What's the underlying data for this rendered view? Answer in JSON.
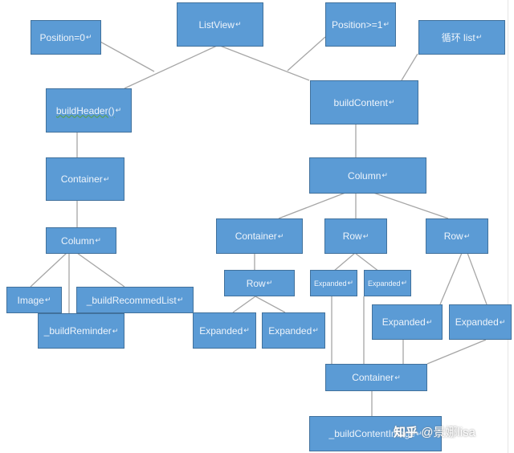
{
  "nodes": {
    "position0": "Position=0",
    "listview": "ListView",
    "position1": "Position>=1",
    "loop_list": "循环 list",
    "build_header": "buildHeader()",
    "build_content": "buildContent",
    "container_left": "Container",
    "column_left": "Column",
    "image": "Image",
    "build_recommed_list": "_buildRecommedList",
    "build_reminder": "_buildReminder",
    "column_right": "Column",
    "container_mid": "Container",
    "row_mid": "Row",
    "row_right": "Row",
    "row_inner": "Row",
    "expanded_a": "Expanded",
    "expanded_b": "Expanded",
    "expanded_small_1": "Expanded",
    "expanded_small_2": "Expanded",
    "expanded_c": "Expanded",
    "expanded_d": "Expanded",
    "container_bottom": "Container",
    "build_content_image": "_buildContentImage"
  },
  "return_mark": "↵",
  "watermark": {
    "brand": "知乎",
    "author": "@景娜lisa"
  }
}
